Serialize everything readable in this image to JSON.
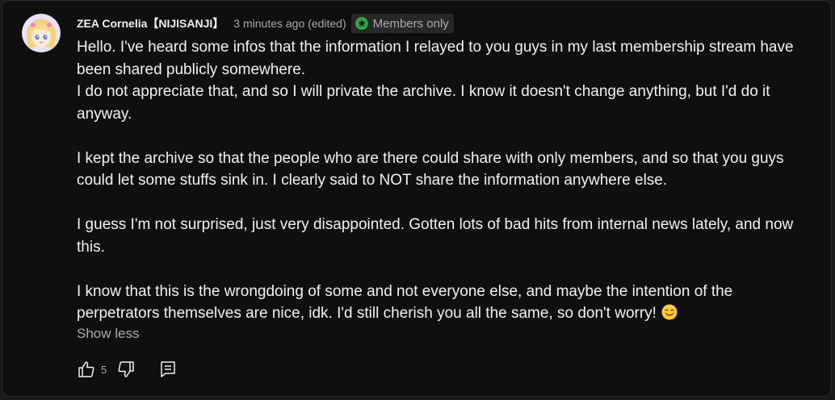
{
  "post": {
    "author": "ZEA Cornelia【NIJISANJI】",
    "timestamp": "3 minutes ago (edited)",
    "badge": {
      "label": "Members only",
      "icon": "members-star-icon",
      "color": "#2ba640"
    },
    "paragraphs": [
      "Hello. I've heard some infos that the information I relayed to you guys in my last membership stream have been shared publicly somewhere.",
      "I do not appreciate that, and so I will private the archive. I know it doesn't change anything, but I'd do it anyway.",
      "",
      "I kept the archive so that the people who are there could share with only members, and so that you guys could let some stuffs sink in. I clearly said to NOT share the information anywhere else.",
      "",
      "I guess I'm not surprised, just very disappointed. Gotten lots of bad hits from internal news lately, and now this.",
      "",
      "I know that this is the wrongdoing of some and not everyone else, and maybe the intention of the perpetrators themselves are nice, idk. I'd still cherish you all the same, so don't worry!"
    ],
    "trailing_emoji": "smiling-face-emoji",
    "show_less_label": "Show less",
    "like_count": "5"
  },
  "colors": {
    "background": "#0f0f0f",
    "text_primary": "#f1f1f1",
    "text_secondary": "#aaaaaa",
    "badge_bg": "#272727"
  }
}
